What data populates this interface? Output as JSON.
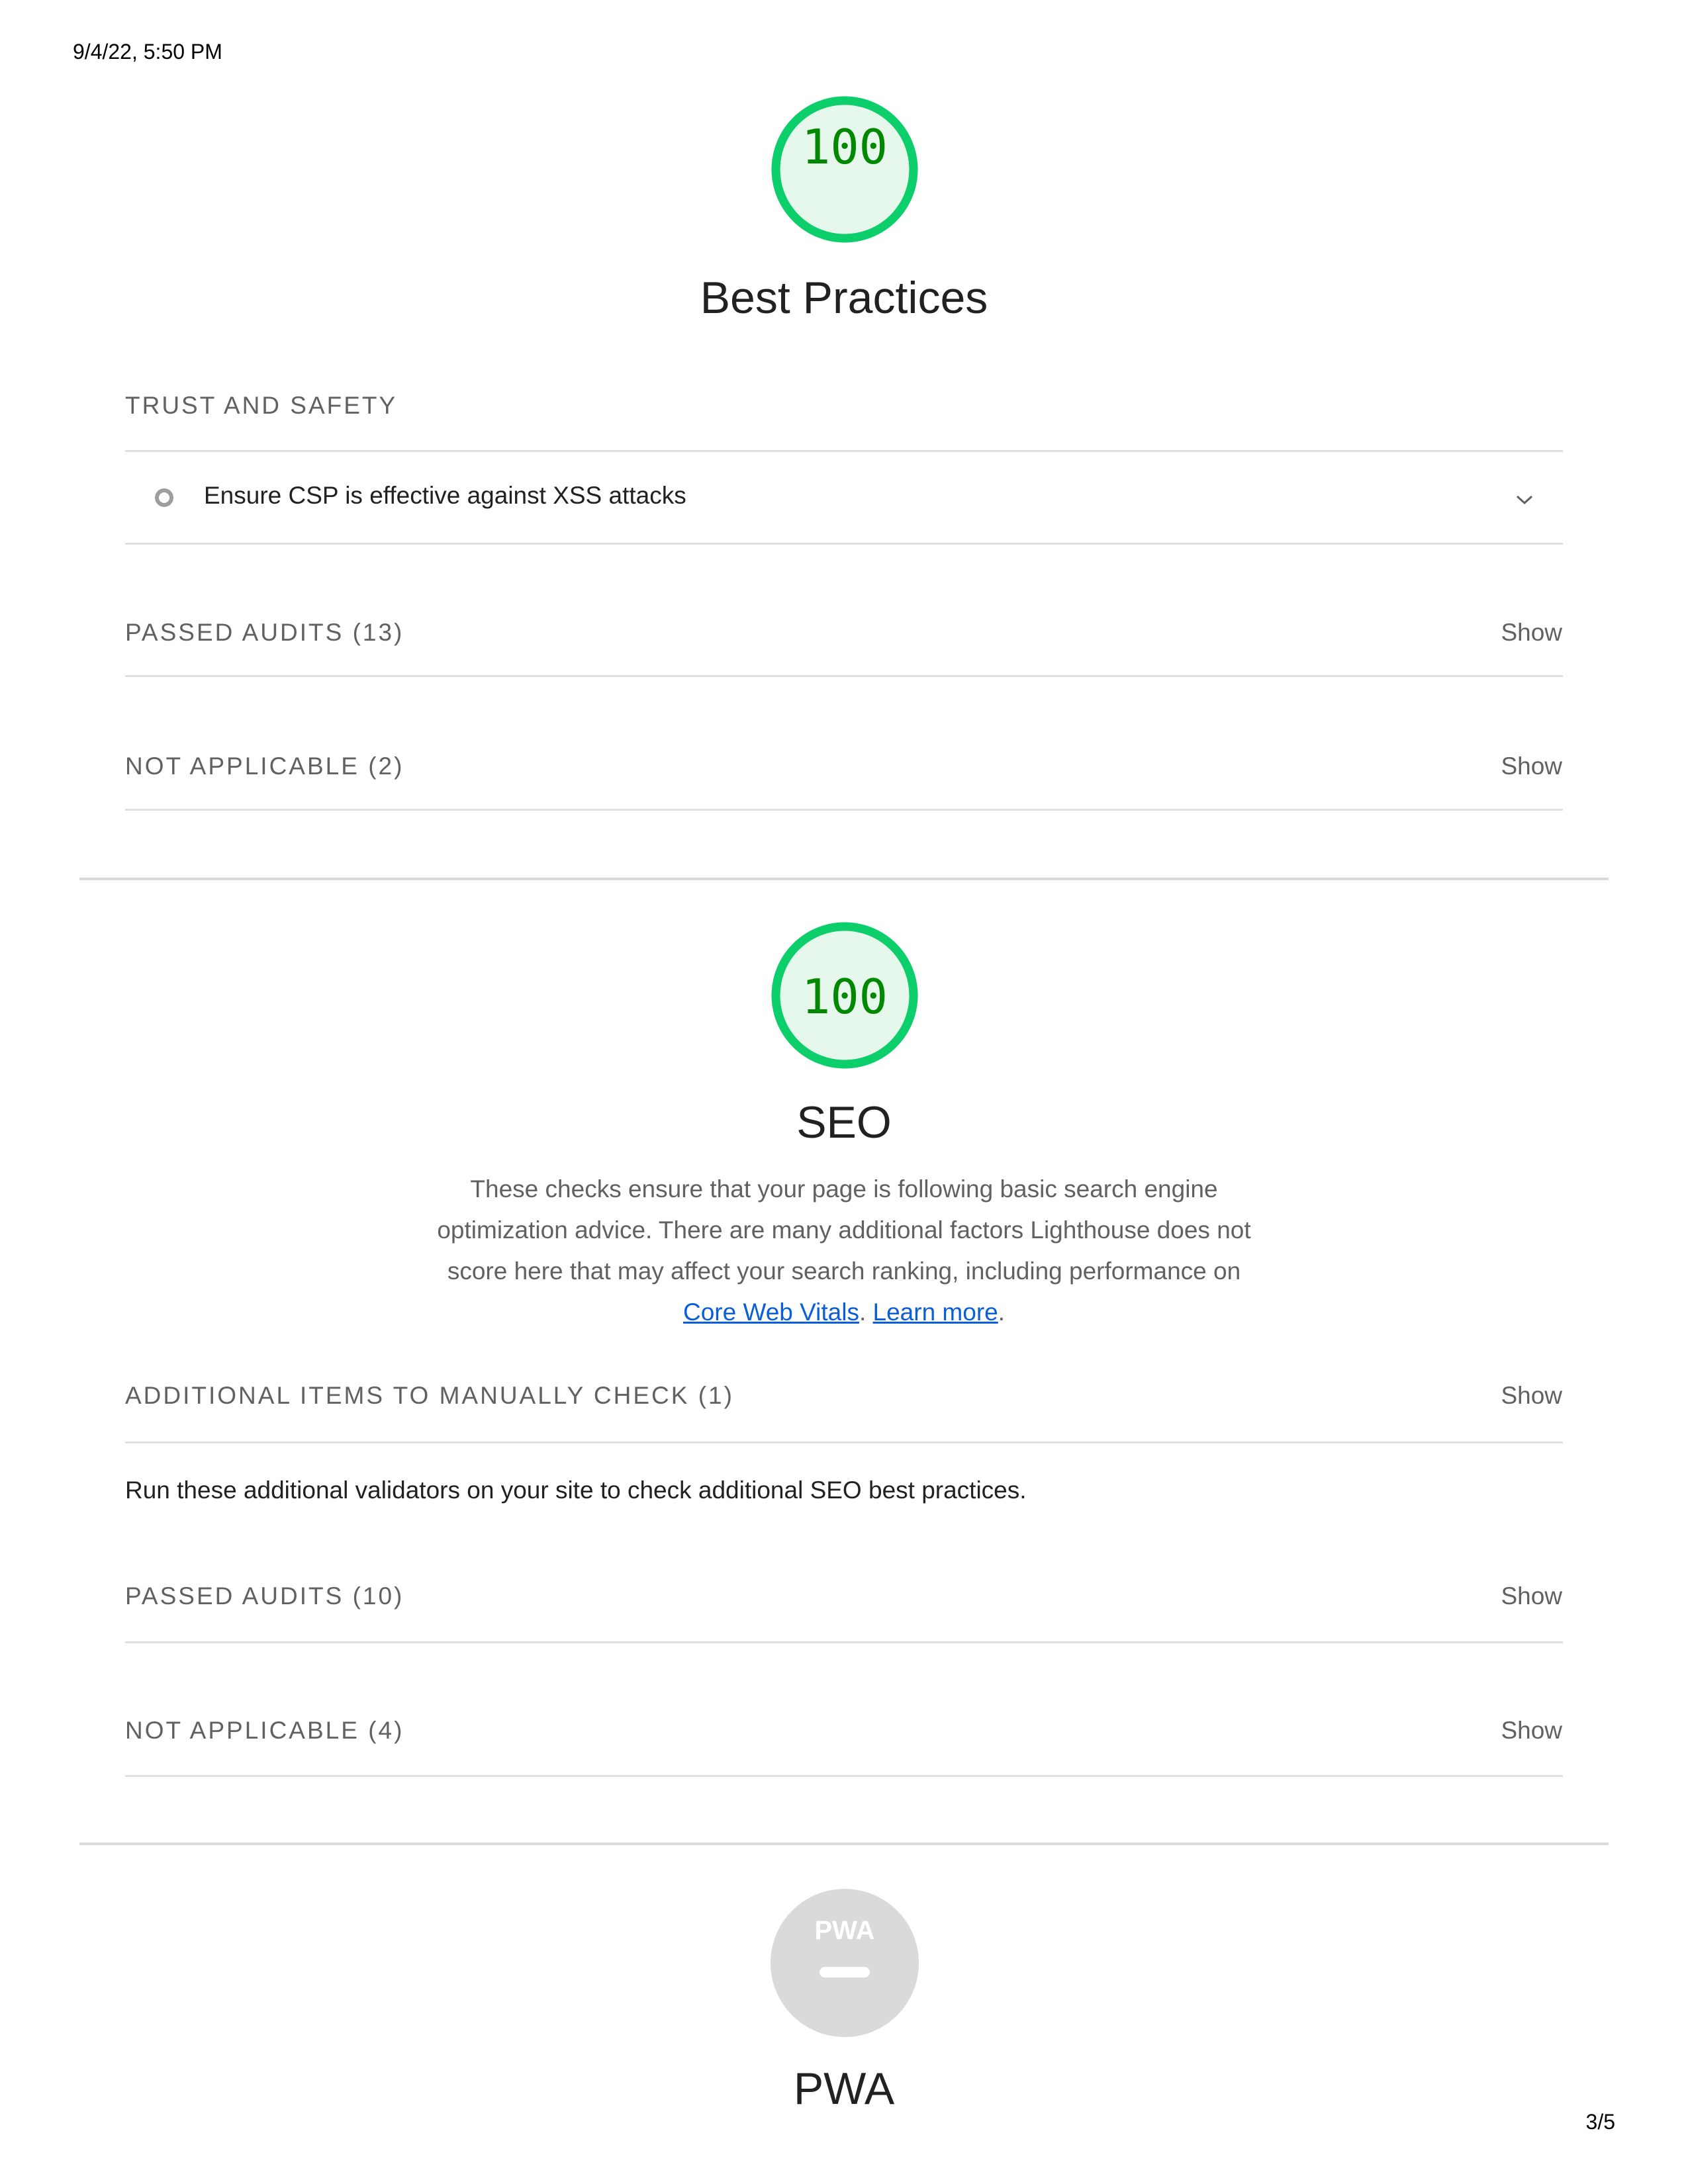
{
  "print": {
    "timestamp": "9/4/22, 5:50 PM",
    "page_number": "3/5"
  },
  "colors": {
    "pass_green": "#0cce6b",
    "pass_fill": "#e6f7ec",
    "pass_text": "#008800",
    "link_blue": "#0a5fd8",
    "neutral_gray": "#dadada"
  },
  "best_practices": {
    "score": "100",
    "title": "Best Practices",
    "groups": {
      "trust_safety": {
        "label": "TRUST AND SAFETY",
        "audits": [
          {
            "title": "Ensure CSP is effective against XSS attacks",
            "status_icon": "informative-circle-icon"
          }
        ]
      },
      "passed": {
        "label": "PASSED AUDITS",
        "count": "(13)",
        "toggle": "Show"
      },
      "not_applicable": {
        "label": "NOT APPLICABLE",
        "count": "(2)",
        "toggle": "Show"
      }
    }
  },
  "seo": {
    "score": "100",
    "title": "SEO",
    "description_text": "These checks ensure that your page is following basic search engine optimization advice. There are many additional factors Lighthouse does not score here that may affect your search ranking, including performance on",
    "description_link_1": "Core Web Vitals",
    "description_separator": ".",
    "description_link_2": "Learn more",
    "description_end": ".",
    "groups": {
      "manual": {
        "label": "ADDITIONAL ITEMS TO MANUALLY CHECK",
        "count": "(1)",
        "toggle": "Show",
        "note": "Run these additional validators on your site to check additional SEO best practices."
      },
      "passed": {
        "label": "PASSED AUDITS",
        "count": "(10)",
        "toggle": "Show"
      },
      "not_applicable": {
        "label": "NOT APPLICABLE",
        "count": "(4)",
        "toggle": "Show"
      }
    }
  },
  "pwa": {
    "badge_text": "PWA",
    "title": "PWA"
  }
}
